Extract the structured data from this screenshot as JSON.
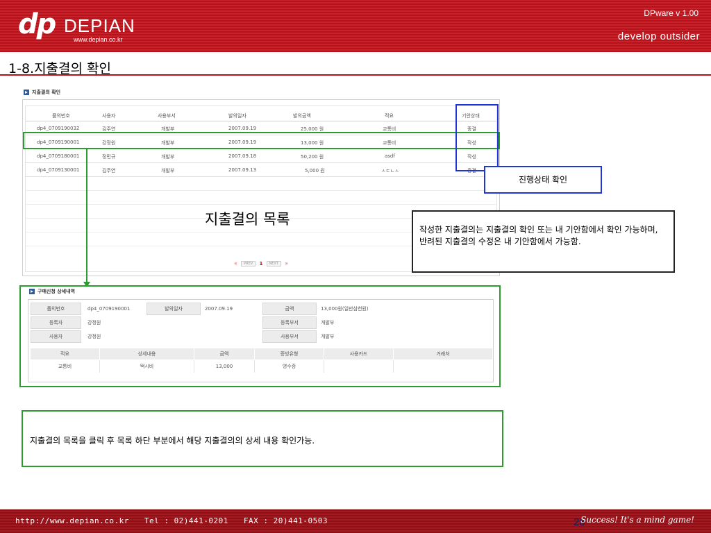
{
  "header": {
    "logo_mark": "dp",
    "logo_name": "DEPIAN",
    "logo_url": "www.depian.co.kr",
    "version": "DPware v 1.00",
    "slogan": "develop outsider"
  },
  "title": "1-8.지출결의 확인",
  "list_section": {
    "label": "지출결의 확인",
    "columns": [
      "품의번호",
      "사용자",
      "사용부서",
      "발의일자",
      "발의금액",
      "적요",
      "기안상태"
    ],
    "rows": [
      [
        "dp4_0709190032",
        "김주연",
        "개발부",
        "2007.09.19",
        "25,000 원",
        "교통비",
        "종결"
      ],
      [
        "dp4_0709190001",
        "강정원",
        "개발부",
        "2007.09.19",
        "13,000 원",
        "교통비",
        "작성"
      ],
      [
        "dp4_0709180001",
        "정민규",
        "개발부",
        "2007.09.18",
        "50,200 원",
        "asdf",
        "작성"
      ],
      [
        "dp4_0709130001",
        "김주연",
        "개발부",
        "2007.09.13",
        "5,000 원",
        "ㅅㄷㄴㅅ",
        "종결"
      ]
    ],
    "pager": {
      "prev": "PREV",
      "page": "1",
      "next": "NEXT"
    }
  },
  "big_label": "지출결의 목록",
  "status_callout": "진행상태 확인",
  "info_text": "작성한 지출결의는 지출결의 확인 또는 내 기안함에서 확인 가능하며, 반려된 지출결의 수정은 내 기안함에서 가능함.",
  "detail_section": {
    "label": "구매신청 상세내역",
    "fields": {
      "doc_no_label": "품의번호",
      "doc_no": "dp4_0709190001",
      "date_label": "발의일자",
      "date": "2007.09.19",
      "amount_label": "금액",
      "amount": "13,000원(일만삼천원)",
      "registrant_label": "등록자",
      "registrant": "강정원",
      "reg_dept_label": "등록부서",
      "reg_dept": "개발부",
      "user_label": "사용자",
      "user": "강정원",
      "use_dept_label": "사용부서",
      "use_dept": "개발부"
    },
    "columns": [
      "적요",
      "상세내용",
      "금액",
      "증빙유형",
      "사용카드",
      "거래처"
    ],
    "row": [
      "교통비",
      "택시비",
      "13,000",
      "영수증",
      "",
      ""
    ]
  },
  "note_text": "지출결의 목록을 클릭 후 목록 하단 부분에서 해당 지출결의의 상세 내용 확인가능.",
  "footer": {
    "url": "http://www.depian.co.kr",
    "tel": "Tel : 02)441-0201",
    "fax": "FAX : 20)441-0503",
    "page_number": "28",
    "slogan": "Success! It's a mind game!"
  }
}
